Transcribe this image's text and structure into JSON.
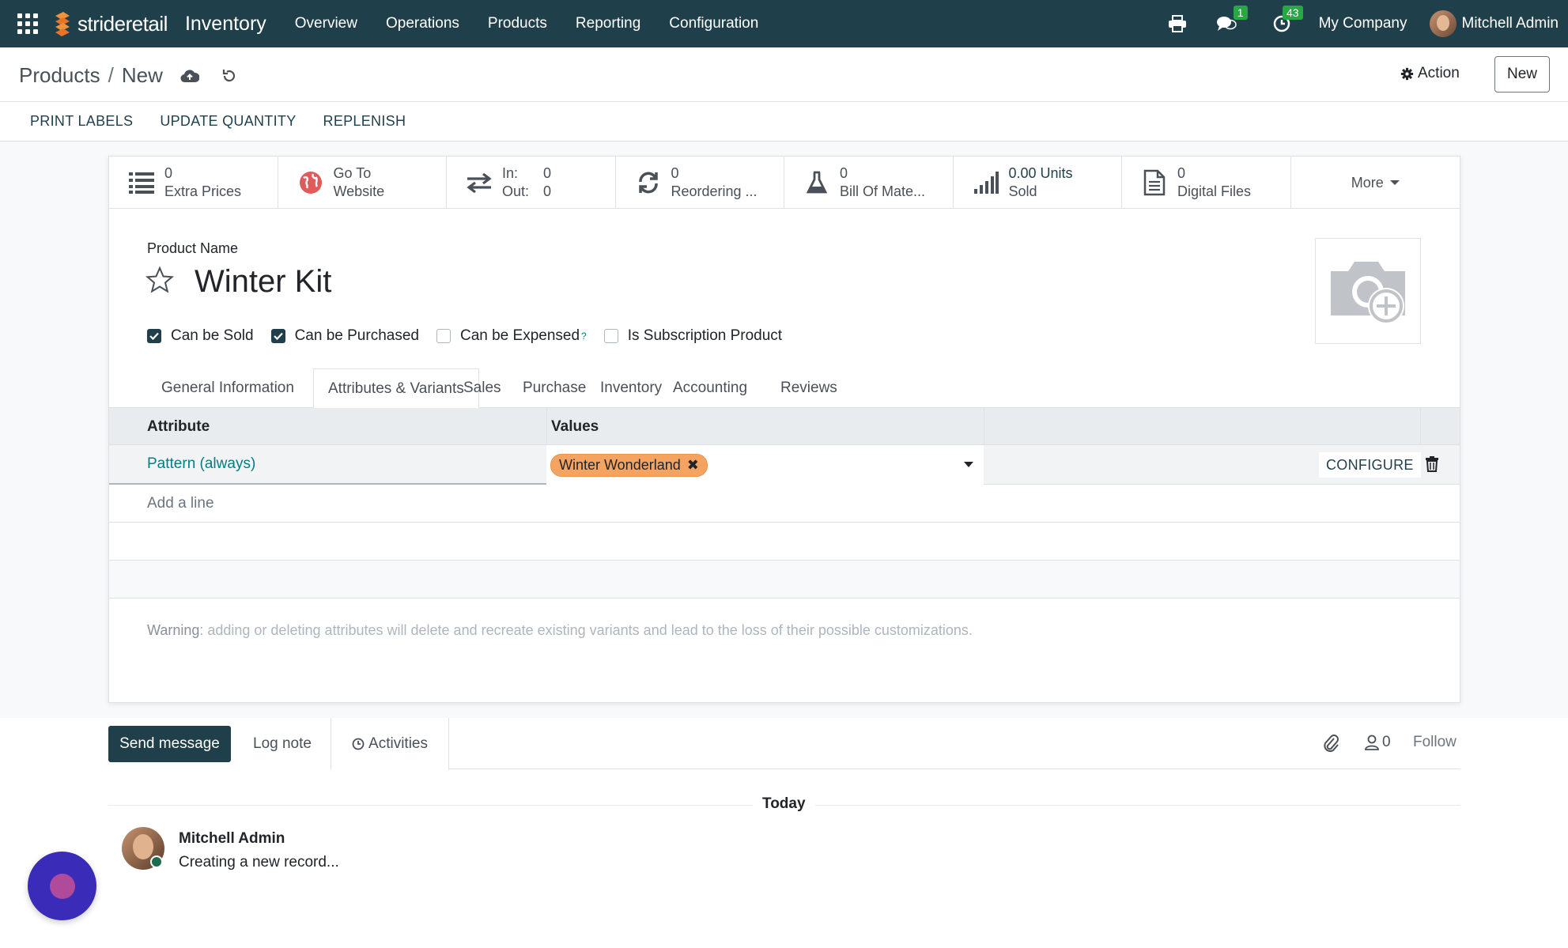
{
  "navbar": {
    "brand": "strideretail",
    "app_name": "Inventory",
    "menu": [
      "Overview",
      "Operations",
      "Products",
      "Reporting",
      "Configuration"
    ],
    "messages_badge": "1",
    "activities_badge": "43",
    "company": "My Company",
    "user": "Mitchell Admin"
  },
  "control_panel": {
    "breadcrumb_parent": "Products",
    "breadcrumb_current": "New",
    "action_label": "Action",
    "new_label": "New"
  },
  "statusbar": {
    "buttons": [
      "PRINT LABELS",
      "UPDATE QUANTITY",
      "REPLENISH"
    ]
  },
  "smart_buttons": {
    "extra_prices": {
      "value": "0",
      "label": "Extra Prices"
    },
    "website": {
      "line1": "Go To",
      "line2": "Website"
    },
    "in_out": {
      "in_label": "In:",
      "in_value": "0",
      "out_label": "Out:",
      "out_value": "0"
    },
    "reordering": {
      "value": "0",
      "label": "Reordering ..."
    },
    "bom": {
      "value": "0",
      "label": "Bill Of Mate..."
    },
    "sold": {
      "value": "0.00 Units",
      "label": "Sold"
    },
    "digital_files": {
      "value": "0",
      "label": "Digital Files"
    },
    "more": "More"
  },
  "form": {
    "product_name_label": "Product Name",
    "product_name": "Winter Kit",
    "checkboxes": [
      {
        "label": "Can be Sold",
        "checked": true
      },
      {
        "label": "Can be Purchased",
        "checked": true
      },
      {
        "label": "Can be Expensed",
        "checked": false,
        "help": "?"
      },
      {
        "label": "Is Subscription Product",
        "checked": false
      }
    ]
  },
  "tabs": [
    "General Information",
    "Attributes & Variants",
    "Sales",
    "Purchase",
    "Inventory",
    "Accounting",
    "Reviews"
  ],
  "active_tab": "Attributes & Variants",
  "attributes_table": {
    "headers": {
      "attribute": "Attribute",
      "values": "Values"
    },
    "rows": [
      {
        "attribute": "Pattern (always)",
        "value_tag": "Winter Wonderland",
        "configure": "CONFIGURE"
      }
    ],
    "add_line": "Add a line",
    "warning_label": "Warning",
    "warning_text": ": adding or deleting attributes will delete and recreate existing variants and lead to the loss of their possible customizations."
  },
  "chatter": {
    "send_message": "Send message",
    "log_note": "Log note",
    "activities": "Activities",
    "followers_count": "0",
    "follow": "Follow",
    "date_separator": "Today",
    "messages": [
      {
        "author": "Mitchell Admin",
        "body": "Creating a new record..."
      }
    ]
  },
  "colors": {
    "navbar": "#1f3f4a",
    "link": "#017e84",
    "tag": "#f4a460",
    "badge": "#28a745"
  }
}
